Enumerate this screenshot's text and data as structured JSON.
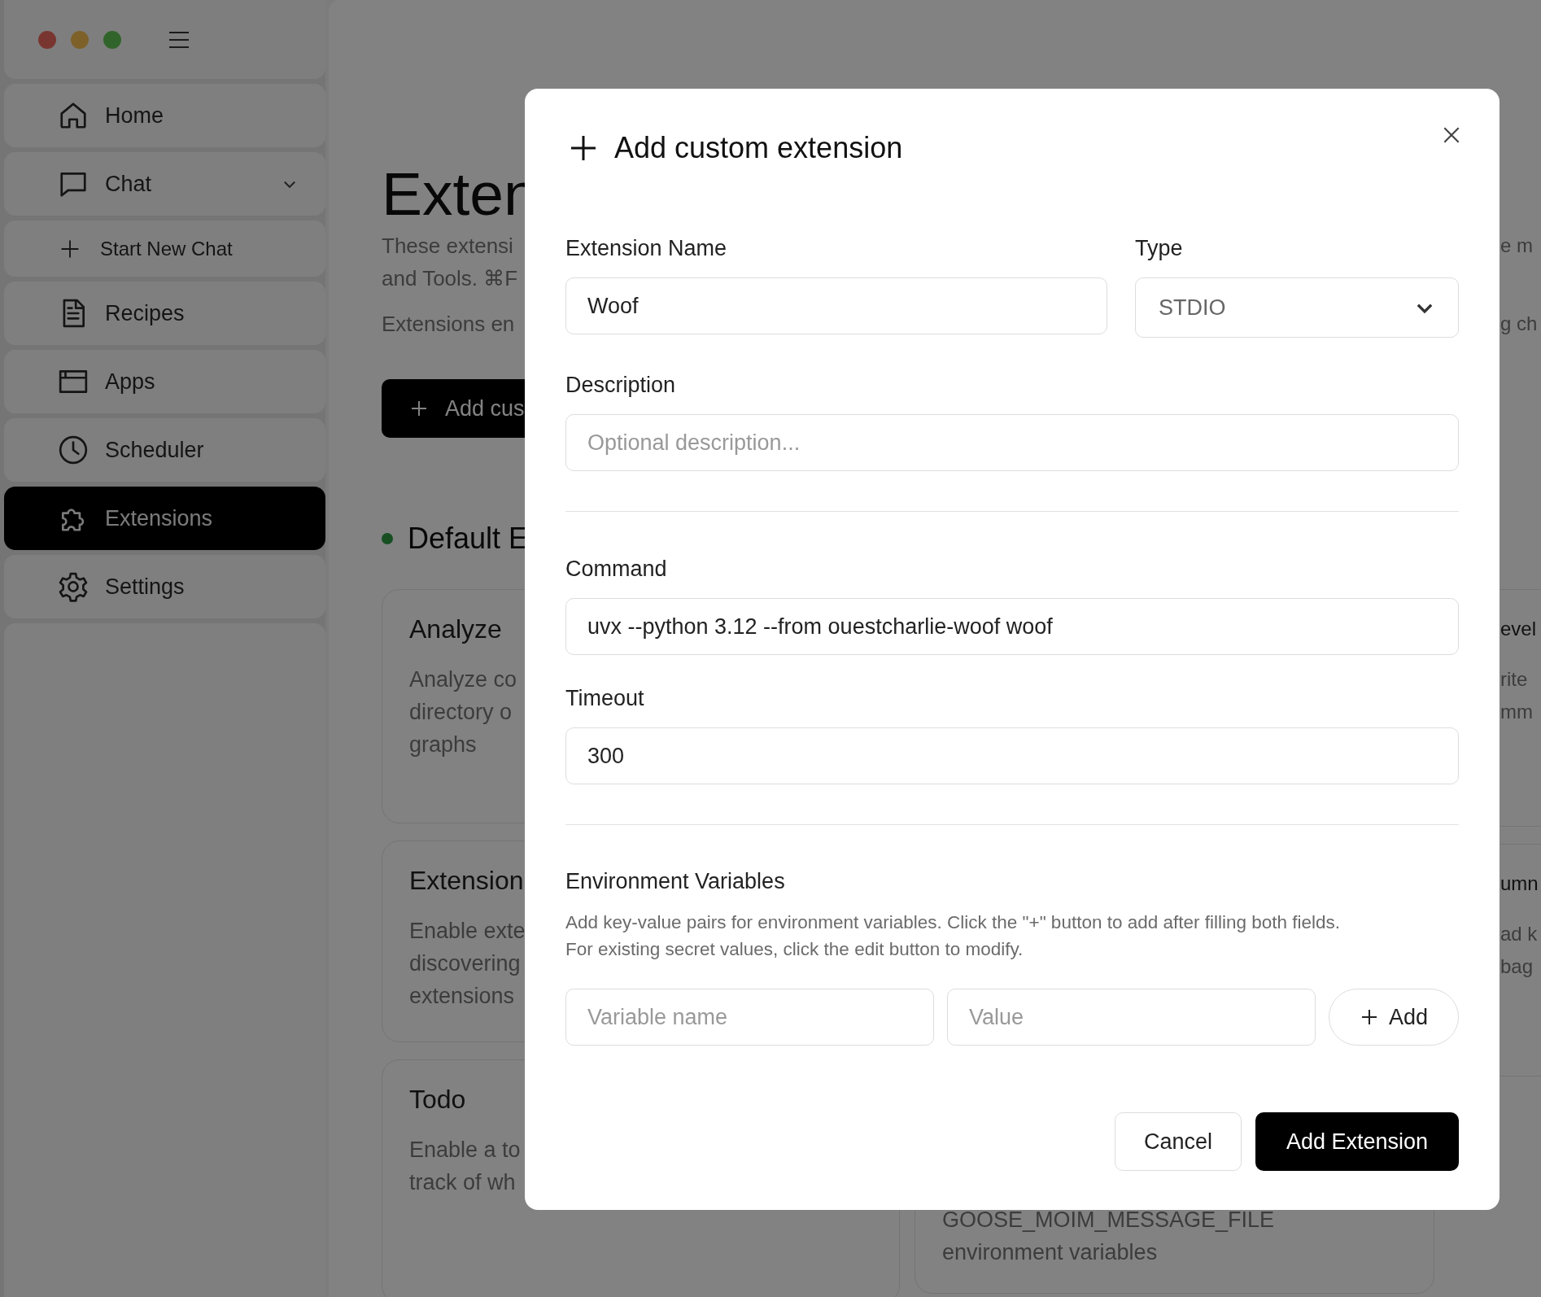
{
  "sidebar": {
    "items": [
      {
        "label": "Home",
        "kind": "nav",
        "selected": false
      },
      {
        "label": "Chat",
        "kind": "group",
        "selected": false,
        "expanded": true
      },
      {
        "label": "Start New Chat",
        "kind": "action",
        "selected": false
      },
      {
        "label": "Recipes",
        "kind": "nav",
        "selected": false
      },
      {
        "label": "Apps",
        "kind": "nav",
        "selected": false
      },
      {
        "label": "Scheduler",
        "kind": "nav",
        "selected": false
      },
      {
        "label": "Extensions",
        "kind": "nav",
        "selected": true
      },
      {
        "label": "Settings",
        "kind": "nav",
        "selected": false
      }
    ]
  },
  "page": {
    "title": "Exten",
    "intro": [
      "These extensi",
      "and Tools. ⌘F"
    ],
    "intro_right": "e m",
    "note": "Extensions en",
    "note_right": "g ch",
    "add_button": "Add cus",
    "section_title": "Default E",
    "cards_left": [
      {
        "title": "Analyze",
        "description": [
          "Analyze co",
          "directory o",
          "graphs"
        ]
      },
      {
        "title": "Extension",
        "description": [
          "Enable exte",
          "discovering",
          "extensions"
        ]
      },
      {
        "title": "Todo",
        "description": [
          "Enable a to",
          "track of wh"
        ]
      }
    ],
    "cards_middle": [
      {
        "description": [
          "GOOSE_MOIM_MESSAGE_FILE",
          "environment variables"
        ]
      }
    ],
    "cards_right": [
      {
        "title": "evel",
        "description": [
          "rite",
          "mm"
        ]
      },
      {
        "title": "umn",
        "description": [
          "ad k",
          "bag"
        ]
      }
    ]
  },
  "dialog": {
    "title": "Add custom extension",
    "name_label": "Extension Name",
    "name_value": "Woof",
    "type_label": "Type",
    "type_value": "STDIO",
    "description_label": "Description",
    "description_placeholder": "Optional description...",
    "command_label": "Command",
    "command_value": "uvx --python 3.12 --from ouestcharlie-woof woof",
    "timeout_label": "Timeout",
    "timeout_value": "300",
    "env_title": "Environment Variables",
    "env_help": "Add key-value pairs for environment variables. Click the \"+\" button to add after filling both fields.\nFor existing secret values, click the edit button to modify.",
    "env_name_placeholder": "Variable name",
    "env_value_placeholder": "Value",
    "add_button": "Add",
    "cancel_button": "Cancel",
    "submit_button": "Add Extension"
  }
}
